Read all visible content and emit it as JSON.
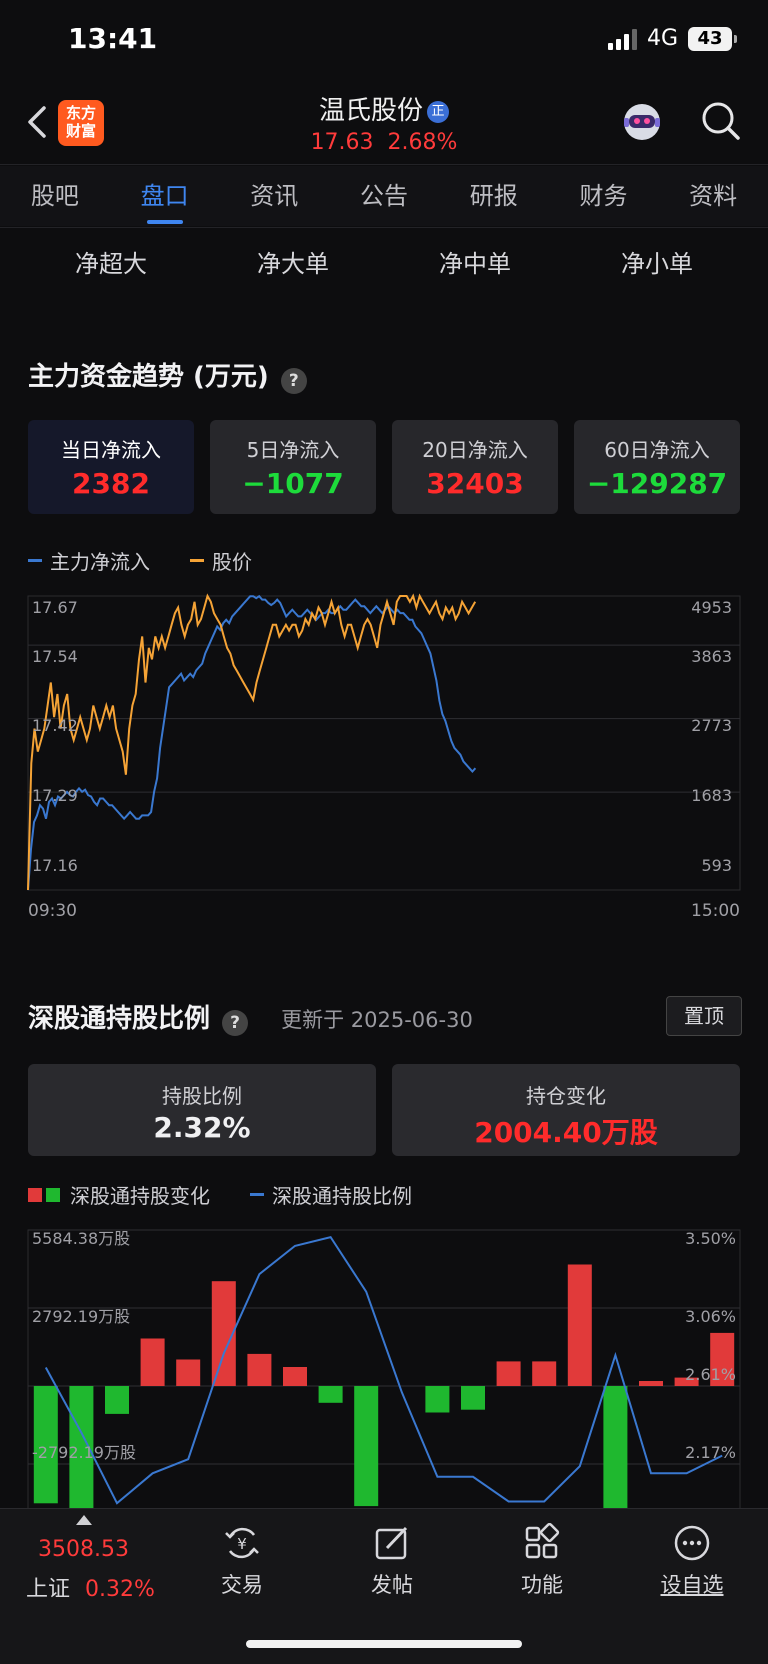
{
  "status": {
    "time": "13:41",
    "network": "4G",
    "battery": "43"
  },
  "header": {
    "logo_line1": "东方",
    "logo_line2": "财富",
    "stock_name": "温氏股份",
    "badge": "正",
    "price": "17.63",
    "change_pct": "2.68%"
  },
  "tabs": [
    "股吧",
    "盘口",
    "资讯",
    "公告",
    "研报",
    "财务",
    "资料"
  ],
  "active_tab": "盘口",
  "subtabs": [
    "净超大",
    "净大单",
    "净中单",
    "净小单"
  ],
  "flow": {
    "title": "主力资金趋势 (万元)",
    "help": "?",
    "cards": [
      {
        "label": "当日净流入",
        "value": "2382",
        "color": "red"
      },
      {
        "label": "5日净流入",
        "value": "−1077",
        "color": "green"
      },
      {
        "label": "20日净流入",
        "value": "32403",
        "color": "red"
      },
      {
        "label": "60日净流入",
        "value": "−129287",
        "color": "green"
      }
    ],
    "legend_main": "主力净流入",
    "legend_price": "股价"
  },
  "colors": {
    "accent": "#3f86f0",
    "up": "#ff2b2b",
    "down": "#1ddb3b",
    "line_blue": "#3a78d0",
    "line_orange": "#f5a336"
  },
  "chart_data": [
    {
      "type": "line",
      "x_start_label": "09:30",
      "x_end_label": "15:00",
      "left_ticks": [
        "17.67",
        "17.54",
        "17.42",
        "17.29",
        "17.16"
      ],
      "right_ticks": [
        "4953",
        "3863",
        "2773",
        "1683",
        "593"
      ],
      "ylim_left": [
        17.16,
        17.67
      ],
      "ylim_right": [
        593,
        4953
      ],
      "series": [
        {
          "name": "主力净流入",
          "axis": "right",
          "color": "blue",
          "values": [
            593,
            1200,
            1600,
            1700,
            1850,
            1800,
            1650,
            1900,
            1950,
            1850,
            1980,
            1950,
            2000,
            2050,
            2000,
            1980,
            2050,
            2100,
            2050,
            2080,
            2000,
            1980,
            1900,
            1850,
            1950,
            1950,
            1900,
            1850,
            1850,
            1800,
            1750,
            1700,
            1650,
            1700,
            1750,
            1700,
            1650,
            1650,
            1700,
            1700,
            1700,
            1750,
            2050,
            2250,
            2700,
            3000,
            3300,
            3600,
            3650,
            3700,
            3750,
            3800,
            3700,
            3750,
            3800,
            3750,
            3850,
            3900,
            3950,
            4100,
            4200,
            4300,
            4400,
            4500,
            4450,
            4550,
            4600,
            4550,
            4650,
            4700,
            4750,
            4800,
            4850,
            4900,
            4950,
            4950,
            4920,
            4950,
            4900,
            4900,
            4850,
            4820,
            4850,
            4900,
            4850,
            4750,
            4650,
            4700,
            4750,
            4700,
            4650,
            4650,
            4700,
            4750,
            4700,
            4650,
            4600,
            4650,
            4700,
            4700,
            4750,
            4700,
            4700,
            4750,
            4800,
            4750,
            4750,
            4800,
            4850,
            4900,
            4850,
            4800,
            4800,
            4750,
            4700,
            4750,
            4800,
            4750,
            4700,
            4750,
            4800,
            4750,
            4700,
            4750,
            4700,
            4700,
            4650,
            4600,
            4600,
            4500,
            4450,
            4400,
            4300,
            4200,
            4100,
            3900,
            3700,
            3400,
            3200,
            3100,
            2950,
            2800,
            2700,
            2650,
            2600,
            2500,
            2450,
            2400,
            2350,
            2400
          ]
        },
        {
          "name": "股价",
          "axis": "left",
          "color": "orange",
          "values": [
            17.16,
            17.38,
            17.44,
            17.4,
            17.42,
            17.44,
            17.48,
            17.52,
            17.46,
            17.5,
            17.44,
            17.48,
            17.5,
            17.44,
            17.42,
            17.44,
            17.46,
            17.44,
            17.42,
            17.44,
            17.48,
            17.46,
            17.44,
            17.46,
            17.48,
            17.46,
            17.48,
            17.44,
            17.42,
            17.4,
            17.36,
            17.44,
            17.48,
            17.5,
            17.56,
            17.6,
            17.52,
            17.58,
            17.56,
            17.6,
            17.58,
            17.6,
            17.58,
            17.6,
            17.62,
            17.64,
            17.65,
            17.62,
            17.6,
            17.62,
            17.63,
            17.66,
            17.62,
            17.63,
            17.65,
            17.68,
            17.66,
            17.64,
            17.63,
            17.62,
            17.6,
            17.58,
            17.57,
            17.55,
            17.54,
            17.53,
            17.52,
            17.51,
            17.5,
            17.49,
            17.52,
            17.54,
            17.56,
            17.58,
            17.6,
            17.62,
            17.62,
            17.6,
            17.61,
            17.62,
            17.61,
            17.62,
            17.62,
            17.6,
            17.61,
            17.63,
            17.62,
            17.64,
            17.63,
            17.65,
            17.64,
            17.62,
            17.64,
            17.66,
            17.64,
            17.65,
            17.62,
            17.6,
            17.62,
            17.62,
            17.6,
            17.58,
            17.6,
            17.62,
            17.63,
            17.62,
            17.6,
            17.58,
            17.62,
            17.64,
            17.66,
            17.64,
            17.62,
            17.66,
            17.68,
            17.7,
            17.68,
            17.66,
            17.67,
            17.65,
            17.67,
            17.66,
            17.65,
            17.64,
            17.65,
            17.66,
            17.64,
            17.63,
            17.65,
            17.64,
            17.65,
            17.63,
            17.64,
            17.66,
            17.65,
            17.64,
            17.65,
            17.66
          ]
        }
      ]
    },
    {
      "type": "bar",
      "bar_series_name": "深股通持股变化",
      "line_series_name": "深股通持股比例",
      "left_ticks": [
        "5584.38万股",
        "2792.19万股",
        "-2792.19万股"
      ],
      "right_ticks": [
        "3.50%",
        "3.06%",
        "2.61%",
        "2.17%"
      ],
      "ylim_bars": [
        -5584.38,
        5584.38
      ],
      "ylim_line": [
        1.73,
        3.5
      ],
      "bar_values": [
        -4200,
        -4400,
        -1000,
        1700,
        950,
        3750,
        1150,
        680,
        -600,
        -4300,
        0,
        -950,
        -850,
        880,
        880,
        4350,
        -4500,
        180,
        300,
        1900
      ],
      "line_values": [
        2.72,
        2.35,
        1.95,
        2.12,
        2.2,
        2.8,
        3.25,
        3.41,
        3.46,
        3.15,
        2.58,
        2.1,
        2.1,
        1.96,
        1.96,
        2.16,
        2.79,
        2.12,
        2.12,
        2.22
      ]
    }
  ],
  "holding": {
    "title": "深股通持股比例",
    "help": "?",
    "updated": "更新于 2025-06-30",
    "pin": "置顶",
    "ratio_label": "持股比例",
    "ratio_value": "2.32%",
    "change_label": "持仓变化",
    "change_value": "2004.40万股"
  },
  "bottom": {
    "index_value": "3508.53",
    "index_name": "上证",
    "index_change": "0.32%",
    "items": [
      "交易",
      "发帖",
      "功能",
      "设自选"
    ]
  }
}
